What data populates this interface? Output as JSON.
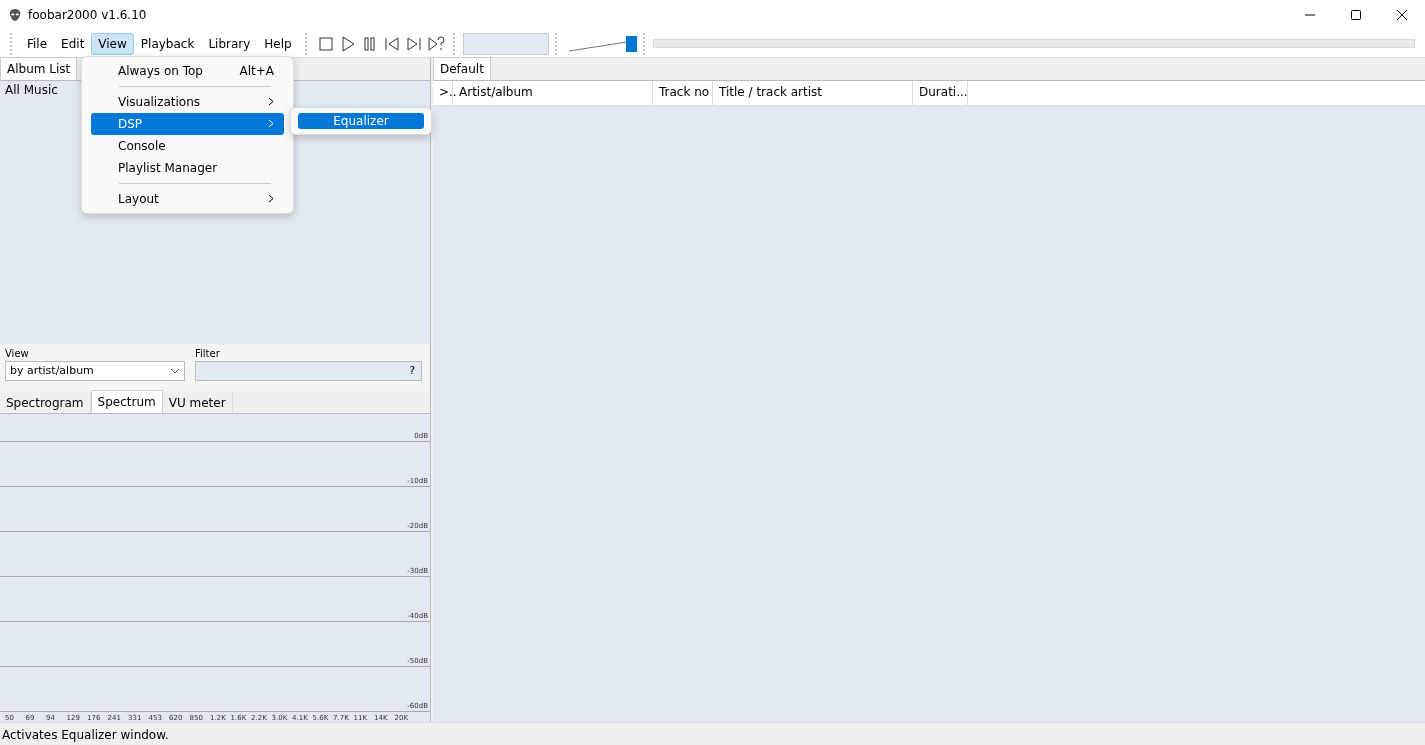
{
  "window": {
    "title": "foobar2000 v1.6.10"
  },
  "menu_bar": [
    {
      "label": "File",
      "selected": false
    },
    {
      "label": "Edit",
      "selected": false
    },
    {
      "label": "View",
      "selected": true
    },
    {
      "label": "Playback",
      "selected": false
    },
    {
      "label": "Library",
      "selected": false
    },
    {
      "label": "Help",
      "selected": false
    }
  ],
  "volume": {
    "level": 1
  },
  "left_tabs": [
    {
      "label": "Album List",
      "selected": true
    }
  ],
  "album_list": {
    "items": [
      "All Music"
    ]
  },
  "view_select": {
    "label": "View",
    "value": "by artist/album"
  },
  "filter": {
    "label": "Filter",
    "help": "?"
  },
  "vis_tabs": [
    {
      "label": "Spectrogram",
      "selected": false
    },
    {
      "label": "Spectrum",
      "selected": true
    },
    {
      "label": "VU meter",
      "selected": false
    }
  ],
  "spectrum": {
    "db_labels": [
      "0dB",
      "-10dB",
      "-20dB",
      "-30dB",
      "-40dB",
      "-50dB",
      "-60dB"
    ],
    "freq_labels": [
      "50",
      "69",
      "94",
      "129",
      "176",
      "241",
      "331",
      "453",
      "620",
      "850",
      "1.2K",
      "1.6K",
      "2.2K",
      "3.0K",
      "4.1K",
      "5.6K",
      "7.7K",
      "11K",
      "14K",
      "20K"
    ]
  },
  "playlist_tabs": [
    {
      "label": "Default",
      "selected": true
    }
  ],
  "playlist": {
    "columns": [
      ">..",
      "Artist/album",
      "Track no",
      "Title / track artist",
      "Durati..."
    ]
  },
  "view_menu": [
    {
      "kind": "item",
      "label": "Always on Top",
      "shortcut": "Alt+A",
      "submenu": false,
      "selected": false
    },
    {
      "kind": "separator"
    },
    {
      "kind": "item",
      "label": "Visualizations",
      "submenu": true,
      "selected": false
    },
    {
      "kind": "item",
      "label": "DSP",
      "submenu": true,
      "selected": true
    },
    {
      "kind": "item",
      "label": "Console",
      "submenu": false,
      "selected": false
    },
    {
      "kind": "item",
      "label": "Playlist Manager",
      "submenu": false,
      "selected": false
    },
    {
      "kind": "separator"
    },
    {
      "kind": "item",
      "label": "Layout",
      "submenu": true,
      "selected": false
    }
  ],
  "dsp_submenu": [
    {
      "label": "Equalizer",
      "selected": true
    }
  ],
  "status_bar": {
    "text": "Activates Equalizer window."
  }
}
